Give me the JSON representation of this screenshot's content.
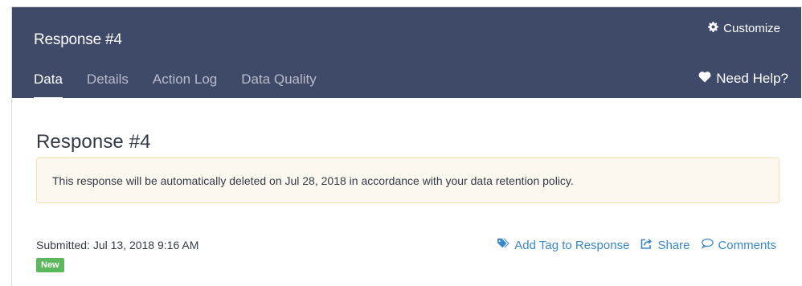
{
  "header": {
    "title": "Response #4",
    "customize_label": "Customize",
    "help_label": "Need Help?",
    "tabs": [
      {
        "label": "Data",
        "active": true
      },
      {
        "label": "Details",
        "active": false
      },
      {
        "label": "Action Log",
        "active": false
      },
      {
        "label": "Data Quality",
        "active": false
      }
    ]
  },
  "main": {
    "title": "Response #4",
    "alert_text": "This response will be automatically deleted on Jul 28, 2018 in accordance with your data retention policy.",
    "submitted_text": "Submitted: Jul 13, 2018 9:16 AM",
    "badge_label": "New",
    "actions": {
      "add_tag": "Add Tag to Response",
      "share": "Share",
      "comments": "Comments"
    }
  },
  "icons": {
    "customize": "gear-icon",
    "help": "heart-icon",
    "add_tag": "tags-icon",
    "share": "share-icon",
    "comments": "comment-icon"
  },
  "colors": {
    "header_bg": "#3f4a68",
    "link": "#3a86c8",
    "badge_green": "#5cb85c",
    "alert_bg": "#fdf8ef",
    "alert_border": "#f1dfb2"
  }
}
